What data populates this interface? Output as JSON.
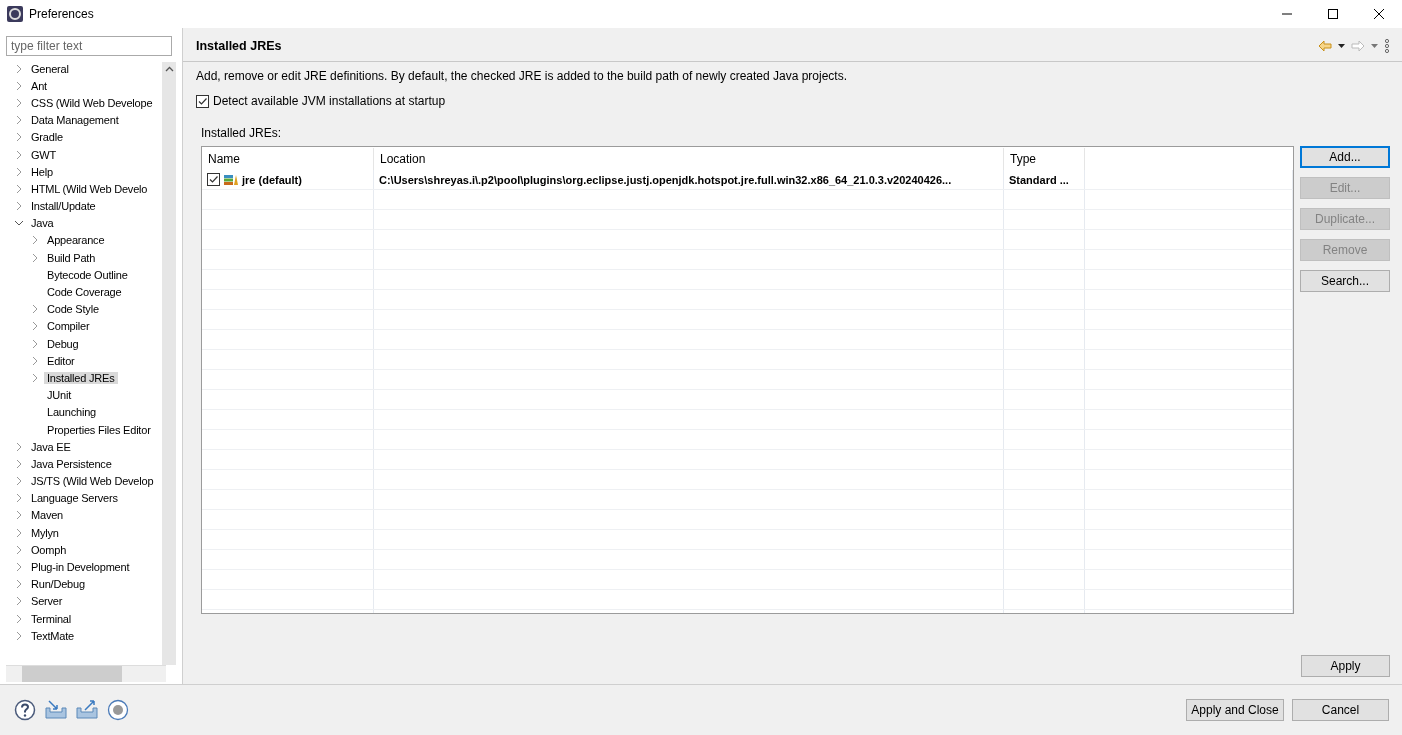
{
  "window": {
    "title": "Preferences"
  },
  "filter": {
    "placeholder": "type filter text"
  },
  "tree": [
    {
      "label": "General",
      "expandable": true,
      "expanded": false,
      "selected": false
    },
    {
      "label": "Ant",
      "expandable": true,
      "expanded": false,
      "selected": false
    },
    {
      "label": "CSS (Wild Web Develope",
      "expandable": true,
      "expanded": false,
      "selected": false
    },
    {
      "label": "Data Management",
      "expandable": true,
      "expanded": false,
      "selected": false
    },
    {
      "label": "Gradle",
      "expandable": true,
      "expanded": false,
      "selected": false
    },
    {
      "label": "GWT",
      "expandable": true,
      "expanded": false,
      "selected": false
    },
    {
      "label": "Help",
      "expandable": true,
      "expanded": false,
      "selected": false
    },
    {
      "label": "HTML (Wild Web Develo",
      "expandable": true,
      "expanded": false,
      "selected": false
    },
    {
      "label": "Install/Update",
      "expandable": true,
      "expanded": false,
      "selected": false
    },
    {
      "label": "Java",
      "expandable": true,
      "expanded": true,
      "selected": false,
      "children": [
        {
          "label": "Appearance",
          "expandable": true,
          "expanded": false,
          "selected": false
        },
        {
          "label": "Build Path",
          "expandable": true,
          "expanded": false,
          "selected": false
        },
        {
          "label": "Bytecode Outline",
          "expandable": false,
          "expanded": false,
          "selected": false
        },
        {
          "label": "Code Coverage",
          "expandable": false,
          "expanded": false,
          "selected": false
        },
        {
          "label": "Code Style",
          "expandable": true,
          "expanded": false,
          "selected": false
        },
        {
          "label": "Compiler",
          "expandable": true,
          "expanded": false,
          "selected": false
        },
        {
          "label": "Debug",
          "expandable": true,
          "expanded": false,
          "selected": false
        },
        {
          "label": "Editor",
          "expandable": true,
          "expanded": false,
          "selected": false
        },
        {
          "label": "Installed JREs",
          "expandable": true,
          "expanded": false,
          "selected": true
        },
        {
          "label": "JUnit",
          "expandable": false,
          "expanded": false,
          "selected": false
        },
        {
          "label": "Launching",
          "expandable": false,
          "expanded": false,
          "selected": false
        },
        {
          "label": "Properties Files Editor",
          "expandable": false,
          "expanded": false,
          "selected": false
        }
      ]
    },
    {
      "label": "Java EE",
      "expandable": true,
      "expanded": false,
      "selected": false
    },
    {
      "label": "Java Persistence",
      "expandable": true,
      "expanded": false,
      "selected": false
    },
    {
      "label": "JS/TS (Wild Web Develop",
      "expandable": true,
      "expanded": false,
      "selected": false
    },
    {
      "label": "Language Servers",
      "expandable": true,
      "expanded": false,
      "selected": false
    },
    {
      "label": "Maven",
      "expandable": true,
      "expanded": false,
      "selected": false
    },
    {
      "label": "Mylyn",
      "expandable": true,
      "expanded": false,
      "selected": false
    },
    {
      "label": "Oomph",
      "expandable": true,
      "expanded": false,
      "selected": false
    },
    {
      "label": "Plug-in Development",
      "expandable": true,
      "expanded": false,
      "selected": false
    },
    {
      "label": "Run/Debug",
      "expandable": true,
      "expanded": false,
      "selected": false
    },
    {
      "label": "Server",
      "expandable": true,
      "expanded": false,
      "selected": false
    },
    {
      "label": "Terminal",
      "expandable": true,
      "expanded": false,
      "selected": false
    },
    {
      "label": "TextMate",
      "expandable": true,
      "expanded": false,
      "selected": false
    }
  ],
  "page": {
    "title": "Installed JREs",
    "description": "Add, remove or edit JRE definitions. By default, the checked JRE is added to the build path of newly created Java projects.",
    "detect": {
      "label": "Detect available JVM installations at startup",
      "checked": true
    },
    "table_label": "Installed JREs:"
  },
  "table": {
    "columns": [
      "Name",
      "Location",
      "Type"
    ],
    "rows": [
      {
        "checked": true,
        "default": true,
        "name": "jre (default)",
        "location": "C:\\Users\\shreyas.i\\.p2\\pool\\plugins\\org.eclipse.justj.openjdk.hotspot.jre.full.win32.x86_64_21.0.3.v20240426...",
        "type": "Standard ..."
      }
    ]
  },
  "side_buttons": [
    {
      "label": "Add...",
      "disabled": false,
      "focused": true
    },
    {
      "label": "Edit...",
      "disabled": true,
      "focused": false
    },
    {
      "label": "Duplicate...",
      "disabled": true,
      "focused": false
    },
    {
      "label": "Remove",
      "disabled": true,
      "focused": false
    },
    {
      "label": "Search...",
      "disabled": false,
      "focused": false
    }
  ],
  "apply": "Apply",
  "footer_buttons": [
    "Apply and Close",
    "Cancel"
  ]
}
